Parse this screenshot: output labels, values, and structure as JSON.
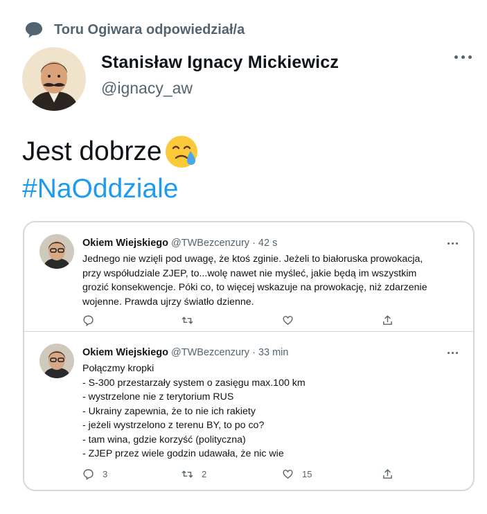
{
  "reply_header": {
    "icon": "speech-bubble-icon",
    "text": "Toru Ogiwara odpowiedział/a"
  },
  "author": {
    "name": "Stanisław Ignacy Mickiewicz",
    "handle": "@ignacy_aw"
  },
  "tweet": {
    "text": "Jest dobrze",
    "emoji": "face-holding-back-tears-emoji",
    "hashtag": "#NaOddziale"
  },
  "quoted": [
    {
      "name": "Okiem Wiejskiego",
      "handle_time": "@TWBezcenzury · 42 s",
      "lines": [
        "Jednego nie wzięli pod uwagę, że ktoś zginie. Jeżeli to białoruska prowokacja,",
        "przy współudziale ZJEP, to...wolę nawet nie myśleć, jakie będą im wszystkim",
        "grozić konsekwencje. Póki co,  to więcej wskazuje na prowokację, niż zdarzenie",
        "wojenne. Prawda ujrzy światło dzienne."
      ],
      "counts": {
        "reply": "",
        "retweet": "",
        "like": ""
      }
    },
    {
      "name": "Okiem Wiejskiego",
      "handle_time": "@TWBezcenzury · 33 min",
      "lines": [
        "Połączmy kropki",
        "- S-300 przestarzały system o zasięgu max.100 km",
        "- wystrzelone nie z terytorium RUS",
        "- Ukrainy zapewnia, że to nie ich rakiety",
        "- jeżeli wystrzelono z terenu BY, to po co?",
        "- tam wina, gdzie korzyść (polityczna)",
        "- ZJEP przez wiele godzin udawała, że nic wie"
      ],
      "counts": {
        "reply": "3",
        "retweet": "2",
        "like": "15"
      }
    }
  ],
  "colors": {
    "accent": "#1d9bf0",
    "secondary_text": "#536471",
    "border": "#cfd9de"
  }
}
